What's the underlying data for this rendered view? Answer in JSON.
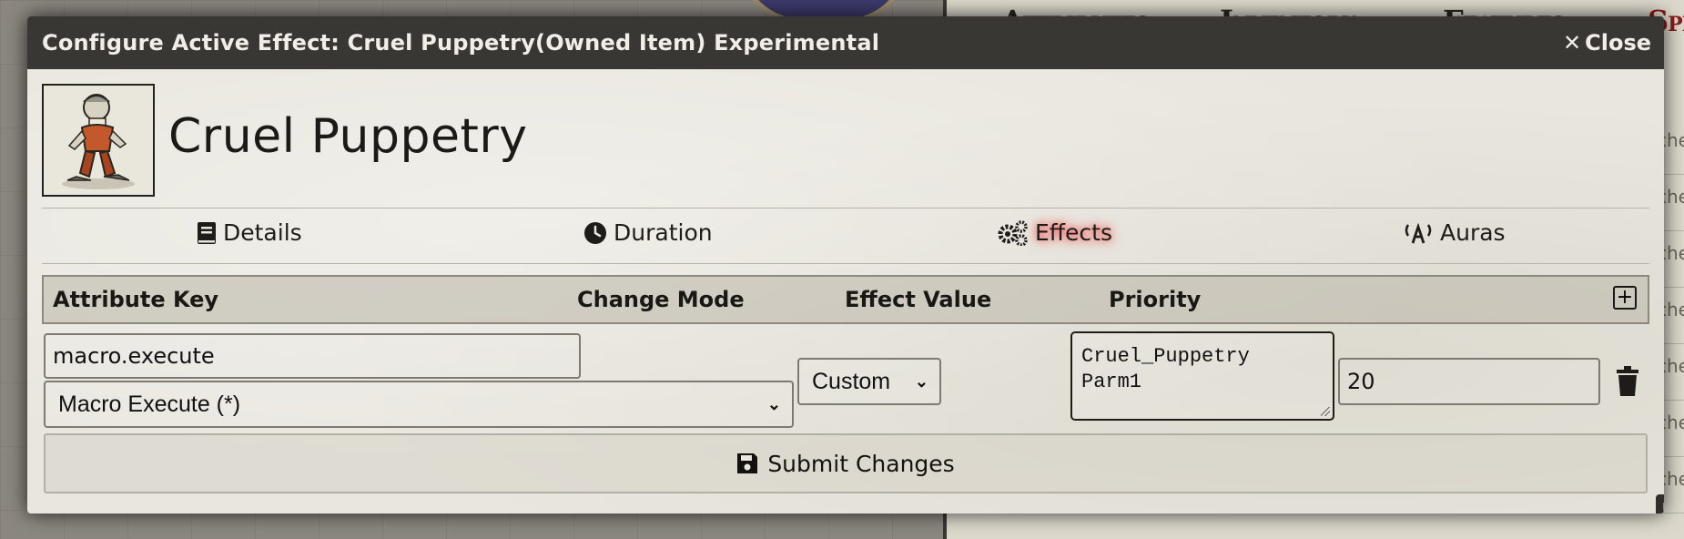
{
  "window": {
    "title": "Configure Active Effect: Cruel Puppetry(Owned Item) Experimental",
    "close_label": "Close"
  },
  "background": {
    "sheet_tabs": [
      "Attributes",
      "Inventory",
      "Features",
      "Spe"
    ],
    "row_fragments": [
      "che",
      "che",
      "che",
      "che",
      "che",
      "che",
      "che"
    ]
  },
  "effect": {
    "name": "Cruel Puppetry",
    "portrait_icon": "puppet-figure-icon"
  },
  "tabs": [
    {
      "label": "Details",
      "icon": "book-icon"
    },
    {
      "label": "Duration",
      "icon": "clock-icon"
    },
    {
      "label": "Effects",
      "icon": "gears-icon",
      "active": true
    },
    {
      "label": "Auras",
      "icon": "broadcast-icon"
    }
  ],
  "table": {
    "headers": {
      "key": "Attribute Key",
      "mode": "Change Mode",
      "value": "Effect Value",
      "priority": "Priority"
    },
    "rows": [
      {
        "key": "macro.execute",
        "preset": "Macro Execute (*)",
        "mode": "Custom",
        "value": "Cruel_Puppetry\nParm1",
        "priority": "20"
      }
    ]
  },
  "submit_label": "Submit Changes",
  "colors": {
    "titlebar": "#2d2c28",
    "active_tab_glow": "#e85050",
    "sheet_accent": "#8a1a1a"
  }
}
